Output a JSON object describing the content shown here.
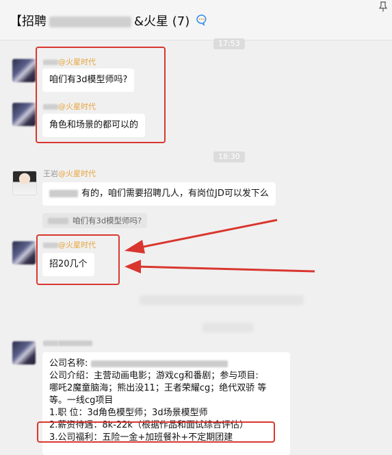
{
  "header": {
    "title_prefix": "【招聘",
    "title_suffix": "&火星 (7)"
  },
  "timestamps": [
    "17:53",
    "18:30"
  ],
  "messages": [
    {
      "sender_tag": "@火星时代",
      "text": "咱们有3d模型师吗?"
    },
    {
      "sender_tag": "@火星时代",
      "text": "角色和场景的都可以的"
    },
    {
      "sender_name": "王岩",
      "sender_tag": "@火星时代",
      "text": "有的，咱们需要招聘几人，有岗位JD可以发下么"
    },
    {
      "quote": "咱们有3d模型师吗?"
    },
    {
      "sender_tag": "@火星时代",
      "text": "招20几个"
    }
  ],
  "job_info": {
    "line1_label": "公司名称:",
    "line2": "公司介绍：主营动画电影；游戏cg和番剧；参与项目:",
    "line3": "哪吒2魔童脑海；熊出没11；王者荣耀cg；绝代双骄 等",
    "line4": "等。一线cg项目",
    "line5": "1.职       位：3d角色模型师；3d场景模型师",
    "line6": "2.薪资待遇：8k-22k（根据作品和面试综合评估）",
    "line7": "3.公司福利：五险一金+加班餐补+不定期团建"
  },
  "colors": {
    "annotation_red": "#d9362f",
    "tag_orange": "#e7a33c"
  }
}
